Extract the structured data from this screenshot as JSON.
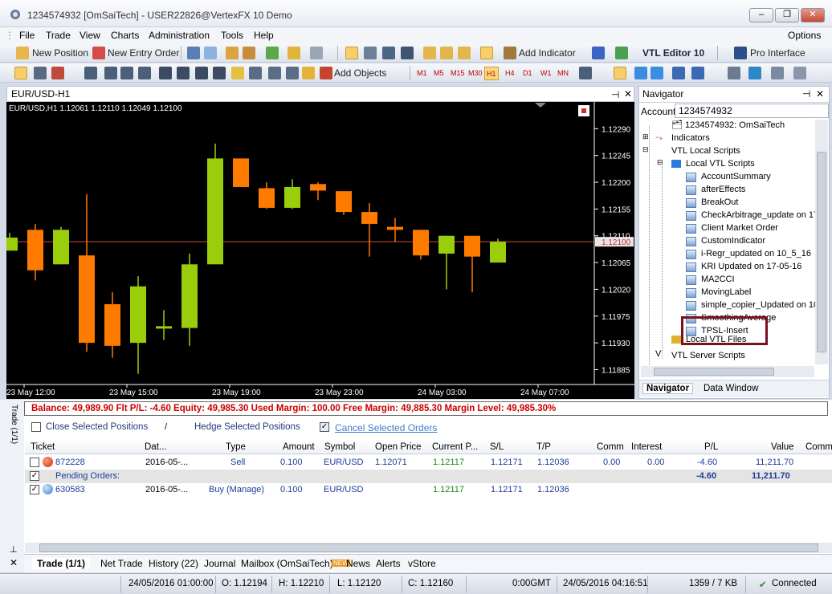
{
  "window": {
    "title": "1234574932 [OmSaiTech] - USER22826@VertexFX 10 Demo"
  },
  "menu": {
    "items": [
      "File",
      "Trade",
      "View",
      "Charts",
      "Administration",
      "Tools",
      "Help"
    ],
    "options": "Options"
  },
  "toolbar1": {
    "new_position": "New Position",
    "new_entry_order": "New Entry Order",
    "vtl_editor": "VTL Editor 10",
    "pro_interface": "Pro Interface"
  },
  "toolbar2": {
    "add_indicator": "Add Indicator",
    "add_objects": "Add Objects",
    "timeframes": [
      "M1",
      "M5",
      "M15",
      "M30",
      "H1",
      "H4",
      "D1",
      "W1",
      "MN"
    ],
    "selected_timeframe": "H1"
  },
  "chart": {
    "tab_title": "EUR/USD-H1",
    "ohlc_label": "EUR/USD,H1  1.12061  1.12110  1.12049  1.12100",
    "price_ticks": [
      "1.12290",
      "1.12245",
      "1.12200",
      "1.12155",
      "1.12110",
      "1.12065",
      "1.12020",
      "1.11975",
      "1.11930",
      "1.11885"
    ],
    "current_price": "1.12100",
    "time_ticks": [
      "23 May 12:00",
      "23 May 15:00",
      "23 May 19:00",
      "23 May 23:00",
      "24 May 03:00",
      "24 May 07:00"
    ],
    "candles": [
      {
        "o": 1.12085,
        "h": 1.12115,
        "l": 1.12085,
        "c": 1.12107
      },
      {
        "o": 1.1212,
        "h": 1.1213,
        "l": 1.12035,
        "c": 1.12052
      },
      {
        "o": 1.12062,
        "h": 1.12125,
        "l": 1.12062,
        "c": 1.1212
      },
      {
        "o": 1.12077,
        "h": 1.1218,
        "l": 1.11915,
        "c": 1.1193
      },
      {
        "o": 1.11995,
        "h": 1.12015,
        "l": 1.11905,
        "c": 1.11925
      },
      {
        "o": 1.1193,
        "h": 1.12042,
        "l": 1.11878,
        "c": 1.12025
      },
      {
        "o": 1.11958,
        "h": 1.11985,
        "l": 1.11935,
        "c": 1.11958
      },
      {
        "o": 1.11955,
        "h": 1.1208,
        "l": 1.11925,
        "c": 1.12062
      },
      {
        "o": 1.12062,
        "h": 1.12265,
        "l": 1.12062,
        "c": 1.1224
      },
      {
        "o": 1.1224,
        "h": 1.1224,
        "l": 1.12195,
        "c": 1.12192
      },
      {
        "o": 1.1219,
        "h": 1.122,
        "l": 1.12155,
        "c": 1.12157
      },
      {
        "o": 1.12157,
        "h": 1.12205,
        "l": 1.12155,
        "c": 1.12192
      },
      {
        "o": 1.12197,
        "h": 1.122,
        "l": 1.1217,
        "c": 1.12186
      },
      {
        "o": 1.12185,
        "h": 1.1217,
        "l": 1.12145,
        "c": 1.1215
      },
      {
        "o": 1.1215,
        "h": 1.12165,
        "l": 1.12075,
        "c": 1.1213
      },
      {
        "o": 1.12125,
        "h": 1.1214,
        "l": 1.121,
        "c": 1.1212
      },
      {
        "o": 1.1212,
        "h": 1.1212,
        "l": 1.1207,
        "c": 1.12077
      },
      {
        "o": 1.1208,
        "h": 1.1211,
        "l": 1.1202,
        "c": 1.1211
      },
      {
        "o": 1.1211,
        "h": 1.1211,
        "l": 1.12015,
        "c": 1.12075
      },
      {
        "o": 1.12065,
        "h": 1.12105,
        "l": 1.12065,
        "c": 1.121
      }
    ]
  },
  "navigator": {
    "title": "Navigator",
    "account_label": "Account",
    "account_value": "1234574932",
    "items": [
      "1234574932: OmSaiTech",
      "Indicators",
      "VTL Local Scripts",
      "Local VTL Scripts",
      "AccountSummary",
      "afterEffects",
      "BreakOut",
      "CheckArbitrage_update on 17",
      "Client Market Order",
      "CustomIndicator",
      "i-Regr_updated on 10_5_16",
      "KRI Updated on 17-05-16",
      "MA2CCI",
      "MovingLabel",
      "simple_copier_Updated on 10",
      "SmoothingAverage",
      "TPSL-Insert",
      "Local VTL Files",
      "VTL Server Scripts"
    ],
    "tabs": [
      "Navigator",
      "Data Window"
    ]
  },
  "trade": {
    "side_label": "Trade (1/1)",
    "balance_line": "Balance: 49,989.90  Flt P/L: -4.60  Equity: 49,985.30  Used Margin: 100.00  Free Margin: 49,885.30  Margin Level: 49,985.30%",
    "close_selected": "Close Selected Positions",
    "slash": "/",
    "hedge_selected": "Hedge Selected Positions",
    "cancel_selected": "Cancel Selected Orders",
    "columns": [
      "Ticket",
      "Dat...",
      "Type",
      "Amount",
      "Symbol",
      "Open Price",
      "Current P...",
      "S/L",
      "T/P",
      "Comm",
      "Interest",
      "P/L",
      "Value",
      "Comm"
    ],
    "rows": [
      {
        "ticket": "872228",
        "date": "2016-05-...",
        "type": "Sell",
        "amount": "0.100",
        "symbol": "EUR/USD",
        "open": "1.12071",
        "current": "1.12117",
        "sl": "1.12171",
        "tp": "1.12036",
        "comm": "0.00",
        "interest": "0.00",
        "pl": "-4.60",
        "value": "11,211.70"
      },
      {
        "ticket": "630583",
        "date": "2016-05-...",
        "type": "Buy (Manage)",
        "amount": "0.100",
        "symbol": "EUR/USD",
        "open": "",
        "current": "1.12117",
        "sl": "1.12171",
        "tp": "1.12036",
        "comm": "",
        "interest": "",
        "pl": "",
        "value": ""
      }
    ],
    "pending_label": "Pending Orders:",
    "pending_pl": "-4.60",
    "pending_value": "11,211.70",
    "tabs": [
      "Trade (1/1)",
      "Net Trade",
      "History (22)",
      "Journal",
      "Mailbox (OmSaiTech)",
      "News",
      "Alerts",
      "vStore"
    ]
  },
  "status": {
    "datetime": "24/05/2016 01:00:00",
    "o": "O: 1.12194",
    "h": "H: 1.12210",
    "l": "L: 1.12120",
    "c": "C: 1.12160",
    "gmt": "0:00GMT",
    "server_time": "24/05/2016 04:16:51",
    "traffic": "1359 / 7 KB",
    "connection": "Connected"
  },
  "colors": {
    "bull": "#9acd0a",
    "bear": "#ff7b00",
    "highlight": "#7a1020",
    "price_line": "#d24a3c"
  }
}
